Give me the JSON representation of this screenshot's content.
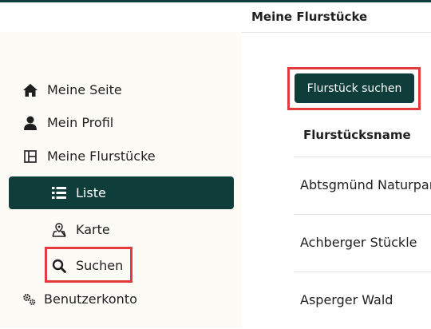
{
  "header": {
    "title": "Meine Flurstücke"
  },
  "sidebar": {
    "items": [
      {
        "label": "Meine Seite",
        "icon": "home-icon"
      },
      {
        "label": "Mein Profil",
        "icon": "user-icon"
      },
      {
        "label": "Meine Flurstücke",
        "icon": "grid-icon"
      },
      {
        "label": "Liste",
        "icon": "list-icon",
        "active": true
      },
      {
        "label": "Karte",
        "icon": "map-icon"
      },
      {
        "label": "Suchen",
        "icon": "search-icon"
      },
      {
        "label": "Benutzerkonto",
        "icon": "gears-icon"
      }
    ]
  },
  "main": {
    "search_button_label": "Flurstück suchen",
    "table": {
      "column_header": "Flurstücksname",
      "rows": [
        "Abtsgmünd Naturpark",
        "Achberger Stückle",
        "Asperger Wald"
      ]
    }
  },
  "colors": {
    "brand": "#0f3d3a",
    "highlight": "#e33a3e",
    "sidebar_bg": "#fcfbf6"
  }
}
